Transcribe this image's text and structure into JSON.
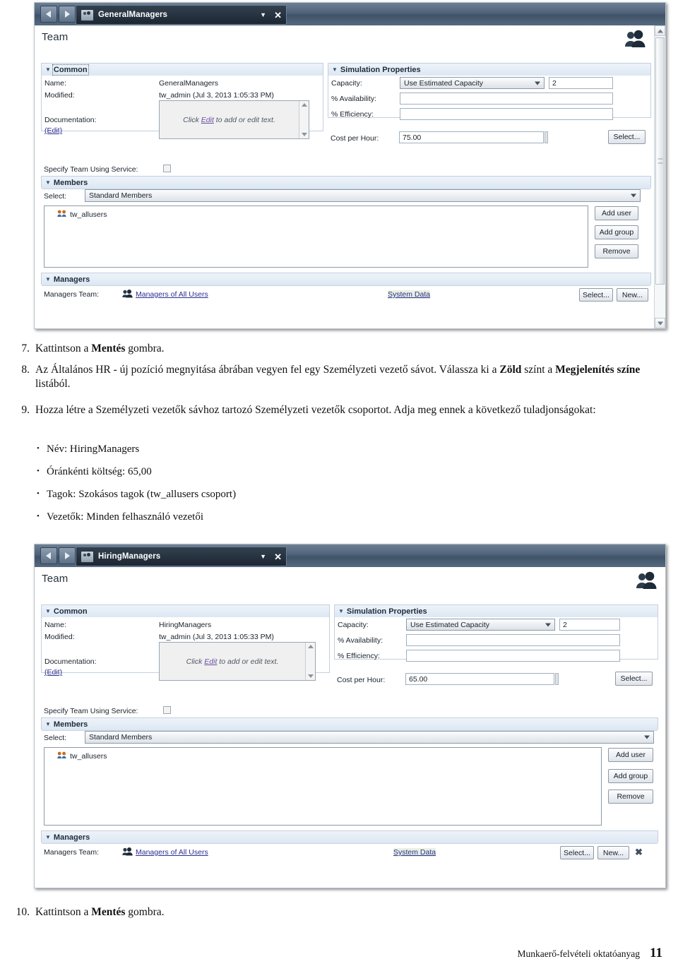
{
  "screenshots": [
    {
      "key": "general",
      "titlebar": {
        "tab_label": "GeneralManagers",
        "caret": "▼",
        "close": "✕"
      },
      "page_title": "Team",
      "common": {
        "header": "Common",
        "name_label": "Name:",
        "name_value": "GeneralManagers",
        "modified_label": "Modified:",
        "modified_value": "tw_admin (Jul 3, 2013 1:05:33 PM)",
        "documentation_label": "Documentation:",
        "edit_link": "(Edit)",
        "doc_placeholder_pre": "Click ",
        "doc_placeholder_link": "Edit",
        "doc_placeholder_post": " to add or edit text.",
        "specify_label": "Specify Team Using Service:"
      },
      "simulation": {
        "header": "Simulation Properties",
        "capacity_label": "Capacity:",
        "capacity_value": "Use Estimated Capacity",
        "capacity_number": "2",
        "availability_label": "% Availability:",
        "availability_value": "",
        "efficiency_label": "% Efficiency:",
        "efficiency_value": "",
        "cost_label": "Cost per Hour:",
        "cost_value": "75.00",
        "select_button": "Select..."
      },
      "members": {
        "header": "Members",
        "select_label": "Select:",
        "select_value": "Standard Members",
        "list": [
          "tw_allusers"
        ],
        "add_user_button": "Add user",
        "add_group_button": "Add group",
        "remove_button": "Remove"
      },
      "managers": {
        "header": "Managers",
        "team_label": "Managers Team:",
        "team_link": "Managers of All Users",
        "system_data_link": "System Data",
        "select_button": "Select...",
        "new_button": "New..."
      },
      "has_scrollbar": true
    },
    {
      "key": "hiring",
      "titlebar": {
        "tab_label": "HiringManagers",
        "caret": "▼",
        "close": "✕"
      },
      "page_title": "Team",
      "common": {
        "header": "Common",
        "name_label": "Name:",
        "name_value": "HiringManagers",
        "modified_label": "Modified:",
        "modified_value": "tw_admin (Jul 3, 2013 1:05:33 PM)",
        "documentation_label": "Documentation:",
        "edit_link": "(Edit)",
        "doc_placeholder_pre": "Click ",
        "doc_placeholder_link": "Edit",
        "doc_placeholder_post": " to add or edit text.",
        "specify_label": "Specify Team Using Service:"
      },
      "simulation": {
        "header": "Simulation Properties",
        "capacity_label": "Capacity:",
        "capacity_value": "Use Estimated Capacity",
        "capacity_number": "2",
        "availability_label": "% Availability:",
        "availability_value": "",
        "efficiency_label": "% Efficiency:",
        "efficiency_value": "",
        "cost_label": "Cost per Hour:",
        "cost_value": "65.00",
        "select_button": "Select..."
      },
      "members": {
        "header": "Members",
        "select_label": "Select:",
        "select_value": "Standard Members",
        "list": [
          "tw_allusers"
        ],
        "add_user_button": "Add user",
        "add_group_button": "Add group",
        "remove_button": "Remove"
      },
      "managers": {
        "header": "Managers",
        "team_label": "Managers Team:",
        "team_link": "Managers of All Users",
        "system_data_link": "System Data",
        "select_button": "Select...",
        "new_button": "New..."
      },
      "has_scrollbar": false
    }
  ],
  "steps": {
    "step7": {
      "num": "7.",
      "pre": "Kattintson a ",
      "bold": "Mentés",
      "post": " gombra."
    },
    "step8": {
      "num": "8.",
      "part1": "Az Általános HR - új pozíció megnyitása ábrában vegyen fel egy Személyzeti vezető sávot. Válassza ki a ",
      "bold1": "Zöld",
      "part2": " színt a ",
      "bold2": "Megjelenítés színe",
      "part3": " listából."
    },
    "step9": {
      "num": "9.",
      "text": "Hozza létre a Személyzeti vezetők sávhoz tartozó Személyzeti vezetők csoportot. Adja meg ennek a következő tuladjonságokat:",
      "bullets": [
        "Név: HiringManagers",
        "Óránkénti költség: 65,00",
        "Tagok: Szokásos tagok (tw_allusers csoport)",
        "Vezetők: Minden felhasználó vezetői"
      ]
    },
    "step10": {
      "num": "10.",
      "pre": "Kattintson a ",
      "bold": "Mentés",
      "post": " gombra."
    }
  },
  "footer": {
    "text": "Munkaerő-felvételi oktatóanyag",
    "page": "11"
  },
  "bullet_glyph": "•",
  "icons": {
    "team": "team-people-icon",
    "group": "user-group-icon",
    "managers": "managers-people-icon"
  }
}
